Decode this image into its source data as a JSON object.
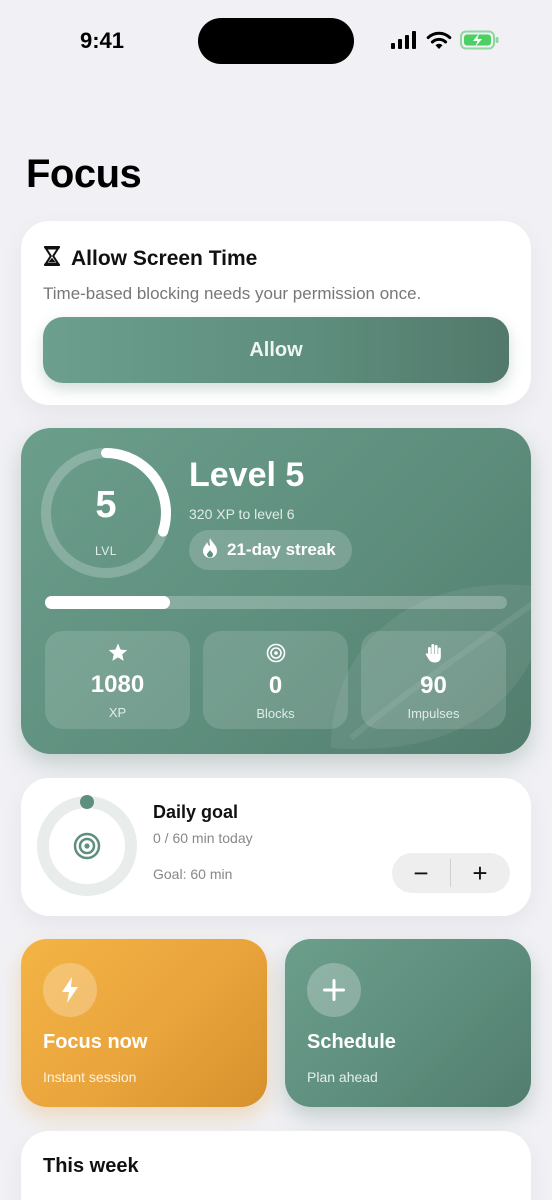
{
  "status_bar": {
    "time": "9:41"
  },
  "page": {
    "title": "Focus"
  },
  "permission": {
    "title": "Allow Screen Time",
    "description": "Time-based blocking needs your permission once.",
    "button_label": "Allow"
  },
  "level": {
    "number": "5",
    "ring_caption": "LVL",
    "ring_progress": 0.3,
    "title": "Level 5",
    "subtitle": "320 XP to level 6",
    "streak_label": "21-day streak",
    "xp_progress": 0.27,
    "stats": [
      {
        "icon": "star-icon",
        "value": "1080",
        "label": "XP"
      },
      {
        "icon": "target-icon",
        "value": "0",
        "label": "Blocks"
      },
      {
        "icon": "hand-icon",
        "value": "90",
        "label": "Impulses"
      }
    ]
  },
  "daily_goal": {
    "title": "Daily goal",
    "progress_text": "0 / 60 min today",
    "goal_text": "Goal: 60 min",
    "progress": 0,
    "minus_label": "−",
    "plus_label": "+"
  },
  "actions": {
    "focus": {
      "title": "Focus now",
      "subtitle": "Instant session"
    },
    "schedule": {
      "title": "Schedule",
      "subtitle": "Plan ahead"
    }
  },
  "week": {
    "title": "This week"
  },
  "colors": {
    "accent_green": "#5e8e7d",
    "accent_orange": "#eea640",
    "background": "#f1f1f5"
  }
}
